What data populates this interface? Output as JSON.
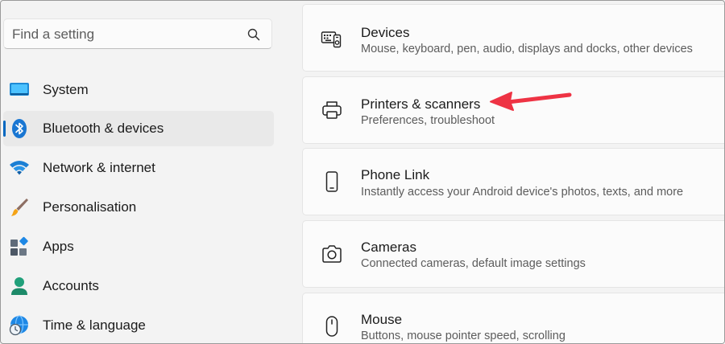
{
  "search": {
    "placeholder": "Find a setting"
  },
  "sidebar": {
    "items": [
      {
        "label": "System",
        "icon": "system-icon",
        "selected": false
      },
      {
        "label": "Bluetooth & devices",
        "icon": "bluetooth-icon",
        "selected": true
      },
      {
        "label": "Network & internet",
        "icon": "wifi-icon",
        "selected": false
      },
      {
        "label": "Personalisation",
        "icon": "brush-icon",
        "selected": false
      },
      {
        "label": "Apps",
        "icon": "apps-icon",
        "selected": false
      },
      {
        "label": "Accounts",
        "icon": "account-icon",
        "selected": false
      },
      {
        "label": "Time & language",
        "icon": "globe-clock-icon",
        "selected": false
      }
    ]
  },
  "main": {
    "cards": [
      {
        "title": "Devices",
        "description": "Mouse, keyboard, pen, audio, displays and docks, other devices",
        "icon": "devices-icon"
      },
      {
        "title": "Printers & scanners",
        "description": "Preferences, troubleshoot",
        "icon": "printer-icon"
      },
      {
        "title": "Phone Link",
        "description": "Instantly access your Android device's photos, texts, and more",
        "icon": "phone-icon"
      },
      {
        "title": "Cameras",
        "description": "Connected cameras, default image settings",
        "icon": "camera-icon"
      },
      {
        "title": "Mouse",
        "description": "Buttons, mouse pointer speed, scrolling",
        "icon": "mouse-icon"
      }
    ]
  },
  "annotation": {
    "arrow_color": "#ee3344",
    "points_to": "Printers & scanners"
  },
  "colors": {
    "accent": "#0067c0",
    "background": "#f3f3f3",
    "card": "#fbfbfb"
  }
}
